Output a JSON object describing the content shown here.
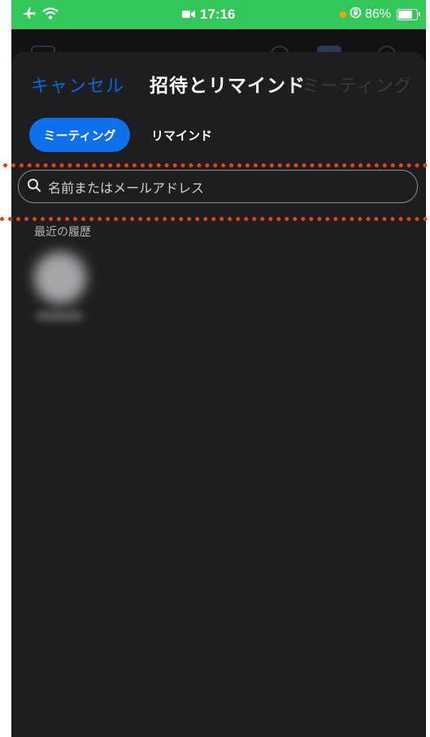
{
  "status_bar": {
    "time": "17:16",
    "battery": "86%",
    "battery_level": 0.86,
    "background_color": "#34c759",
    "icons": [
      "airplane-icon",
      "wifi-icon",
      "video-camera-icon",
      "orange-dot-icon",
      "orientation-lock-icon",
      "battery-icon"
    ]
  },
  "nav": {
    "cancel_label": "キャンセル",
    "title": "招待とリマインド",
    "right_label": "ミーティング"
  },
  "segments": [
    {
      "label": "ミーティング",
      "selected": true
    },
    {
      "label": "リマインド",
      "selected": false
    }
  ],
  "search": {
    "placeholder": "名前またはメールアドレス"
  },
  "recent": {
    "section_label": "最近の履歴"
  },
  "colors": {
    "accent": "#0e71eb",
    "annotation": "#e8401c",
    "sheet_background": "#1e1e20"
  }
}
